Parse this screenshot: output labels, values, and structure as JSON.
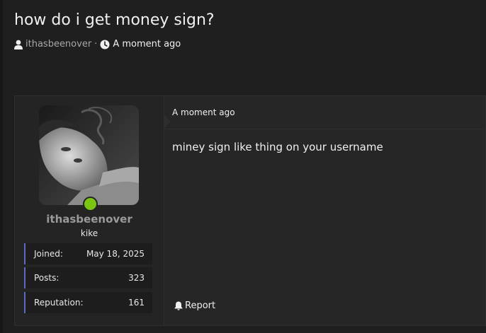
{
  "thread": {
    "title": "how do i get money sign?",
    "author": "ithasbeenover",
    "separator": "·",
    "time": "A moment ago"
  },
  "post": {
    "date": "A moment ago",
    "body": "miney sign like thing on your username",
    "report_label": "Report"
  },
  "author_card": {
    "username": "ithasbeenover",
    "user_title": "kike",
    "online": true,
    "stats": [
      {
        "label": "Joined:",
        "value": "May 18, 2025"
      },
      {
        "label": "Posts:",
        "value": "323"
      },
      {
        "label": "Reputation:",
        "value": "161"
      }
    ]
  },
  "icons": {
    "meta_author": "user-icon",
    "meta_time": "clock-icon",
    "report": "bell-icon"
  },
  "colors": {
    "background": "#1f1f1f",
    "post_background": "#262626",
    "online": "#7cc413",
    "stat_accent": "#5c6bc0",
    "muted_text": "#a8a8a8"
  }
}
